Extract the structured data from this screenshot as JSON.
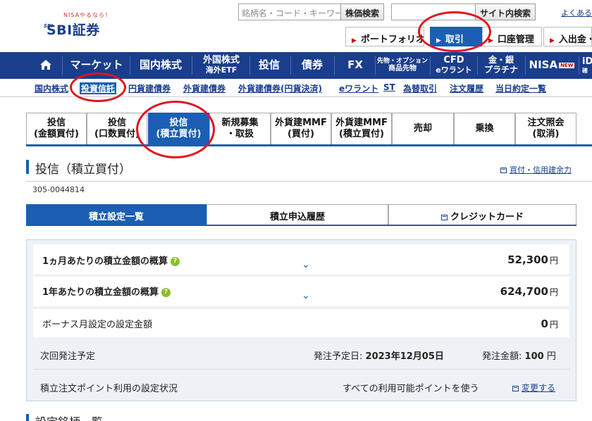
{
  "header": {
    "logo_small": "NISAやるなら！",
    "logo_mark": "SBI",
    "logo_main": "SBI証券",
    "stock_search": {
      "placeholder": "銘柄名・コード・キーワード",
      "button": "株価検索"
    },
    "site_search": {
      "placeholder": "",
      "button": "サイト内検索"
    },
    "help_link": "よくあるご",
    "tabs": [
      {
        "label": "ポートフォリオ",
        "active": false
      },
      {
        "label": "取引",
        "active": true
      },
      {
        "label": "口座管理",
        "active": false
      },
      {
        "label": "入出金・",
        "active": false
      }
    ]
  },
  "nav": {
    "home_icon": "home-icon",
    "items": [
      {
        "label": "マーケット",
        "sub": ""
      },
      {
        "label": "国内株式",
        "sub": ""
      },
      {
        "label": "外国株式",
        "sub": "海外ETF"
      },
      {
        "label": "投信",
        "sub": ""
      },
      {
        "label": "債券",
        "sub": ""
      },
      {
        "label": "FX",
        "sub": ""
      },
      {
        "label": "先物・オプション",
        "sub": "商品先物"
      },
      {
        "label": "CFD",
        "sub": "eワラント"
      },
      {
        "label": "金・銀",
        "sub": "プラチナ"
      },
      {
        "label": "NISA",
        "sub": "",
        "badge": "NEW"
      },
      {
        "label": "iD",
        "sub": "確"
      }
    ]
  },
  "sublinks": [
    {
      "label": "国内株式",
      "active": false
    },
    {
      "label": "投資信託",
      "active": true
    },
    {
      "label": "円貨建債券",
      "active": false
    },
    {
      "label": "外貨建債券",
      "active": false
    },
    {
      "label": "外貨建債券(円貨決済)",
      "active": false
    },
    {
      "label": "eワラント",
      "active": false
    },
    {
      "label": "ST",
      "active": false
    },
    {
      "label": "為替取引",
      "active": false
    },
    {
      "label": "注文履歴",
      "active": false
    },
    {
      "label": "当日約定一覧",
      "active": false
    }
  ],
  "order_tabs": [
    {
      "line1": "投信",
      "line2": "(金額買付)",
      "active": false
    },
    {
      "line1": "投信",
      "line2": "(口数買付)",
      "active": false
    },
    {
      "line1": "投信",
      "line2": "(積立買付)",
      "active": true
    },
    {
      "line1": "新規募集",
      "line2": "・取扱",
      "active": false
    },
    {
      "line1": "外貨建MMF",
      "line2": "(買付)",
      "active": false
    },
    {
      "line1": "外貨建MMF",
      "line2": "(積立買付)",
      "active": false
    },
    {
      "line1": "売却",
      "line2": "",
      "active": false
    },
    {
      "line1": "乗換",
      "line2": "",
      "active": false
    },
    {
      "line1": "注文照会",
      "line2": "(取消)",
      "active": false
    }
  ],
  "page": {
    "title": "投信（積立買付）",
    "right_link": "買付・信用建余力",
    "account_number": "305-0044814"
  },
  "sub_tabs": [
    {
      "label": "積立設定一覧",
      "active": true
    },
    {
      "label": "積立申込履歴",
      "active": false
    },
    {
      "label": "クレジットカード",
      "active": false
    }
  ],
  "summary": {
    "monthly": {
      "label": "1ヵ月あたりの積立金額の概算",
      "value": "52,300",
      "unit": "円"
    },
    "yearly": {
      "label": "1年あたりの積立金額の概算",
      "value": "624,700",
      "unit": "円"
    },
    "bonus": {
      "label": "ボーナス月設定の設定金額",
      "value": "0",
      "unit": "円"
    },
    "next_order": {
      "label": "次回発注予定",
      "date_label": "発注予定日:",
      "date_value": "2023年12月05日",
      "amount_label": "発注金額:",
      "amount_value": "100",
      "amount_unit": "円"
    },
    "points": {
      "label": "積立注文ポイント利用の設定状況",
      "value": "すべての利用可能ポイントを使う",
      "link": "変更する"
    }
  },
  "bottom_title": "設定銘柄一覧",
  "colors": {
    "brand_blue": "#1a3e8c",
    "active_blue": "#1a5fb4",
    "annotation_red": "#e0141e",
    "help_green": "#8bbf2d"
  }
}
